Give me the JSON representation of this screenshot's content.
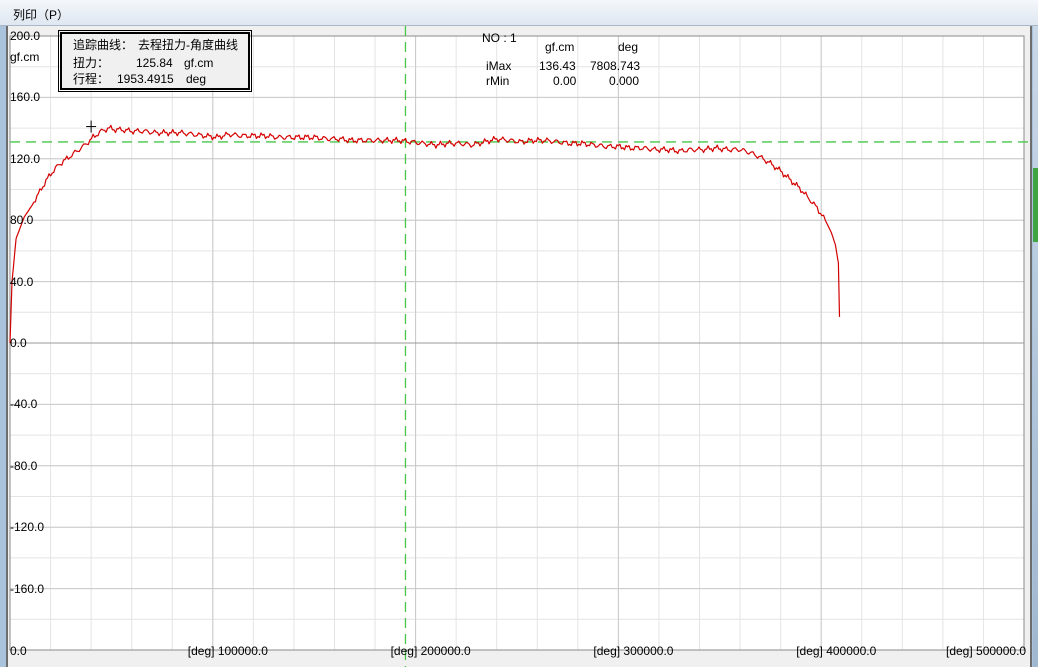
{
  "menu": {
    "print_label": "列印（P）"
  },
  "info_box": {
    "trace_label": "追踪曲线：",
    "trace_value": "去程扭力-角度曲线",
    "torque_label": "扭力：",
    "torque_value": "125.84",
    "torque_unit": "gf.cm",
    "travel_label": "行程：",
    "travel_value": "1953.4915",
    "travel_unit": "deg"
  },
  "stats": {
    "no_label": "NO : 1",
    "col1_header": "gf.cm",
    "col2_header": "deg",
    "rows": [
      {
        "label": "iMax",
        "v1": "136.43",
        "v2": "7808.743"
      },
      {
        "label": "rMin",
        "v1": "0.00",
        "v2": "0.000"
      }
    ]
  },
  "chart_data": {
    "type": "line",
    "ylabel": "gf.cm",
    "ylim": [
      -200,
      200
    ],
    "xlim": [
      0,
      500000
    ],
    "y_ticks": [
      "200.0",
      "160.0",
      "120.0",
      "80.0",
      "40.0",
      "0.0",
      "-40.0",
      "-80.0",
      "-120.0",
      "-160.0"
    ],
    "y_tick_values": [
      200,
      160,
      120,
      80,
      40,
      0,
      -40,
      -80,
      -120,
      -160
    ],
    "x_origin_label": "0.0",
    "x_unit_label": "[deg]",
    "x_ticks": [
      "100000.0",
      "200000.0",
      "300000.0",
      "400000.0",
      "500000.0"
    ],
    "x_tick_values": [
      100000,
      200000,
      300000,
      400000,
      500000
    ],
    "cursor": {
      "x": 195000,
      "y": 131
    },
    "series": [
      {
        "color": "#d40000",
        "x": [
          0,
          1000,
          3000,
          5000,
          7000,
          9000,
          11000,
          14000,
          17000,
          20000,
          24000,
          28000,
          32000,
          37000,
          41000,
          45000,
          49000,
          52000,
          55000,
          60000,
          66000,
          72000,
          78000,
          84000,
          90000,
          96000,
          102000,
          108000,
          114000,
          120000,
          126000,
          132000,
          138000,
          144000,
          150000,
          156000,
          162000,
          168000,
          174000,
          180000,
          186000,
          192000,
          198000,
          204000,
          210000,
          216000,
          222000,
          228000,
          234000,
          240000,
          246000,
          252000,
          258000,
          264000,
          270000,
          276000,
          282000,
          288000,
          294000,
          300000,
          306000,
          312000,
          318000,
          324000,
          330000,
          336000,
          342000,
          348000,
          354000,
          360000,
          365000,
          370000,
          375000,
          380000,
          385000,
          390000,
          394000,
          398000,
          402000,
          405000,
          407000,
          408500,
          409000
        ],
        "y": [
          0,
          40,
          68,
          75,
          82,
          86,
          90,
          97,
          104,
          110,
          116,
          120,
          124,
          129,
          134,
          138,
          140,
          139,
          139,
          138,
          138,
          137,
          137,
          137,
          136,
          135,
          134,
          136,
          135,
          135,
          135,
          134,
          134,
          134,
          134,
          133,
          133,
          132,
          132,
          132,
          132,
          132,
          131,
          130,
          129,
          130,
          130,
          129,
          131,
          133,
          132,
          131,
          132,
          132,
          131,
          130,
          130,
          129,
          128,
          128,
          127,
          127,
          126,
          126,
          125,
          126,
          126,
          127,
          126,
          126,
          124,
          121,
          117,
          112,
          106,
          100,
          94,
          88,
          80,
          72,
          64,
          52,
          17
        ]
      }
    ]
  }
}
